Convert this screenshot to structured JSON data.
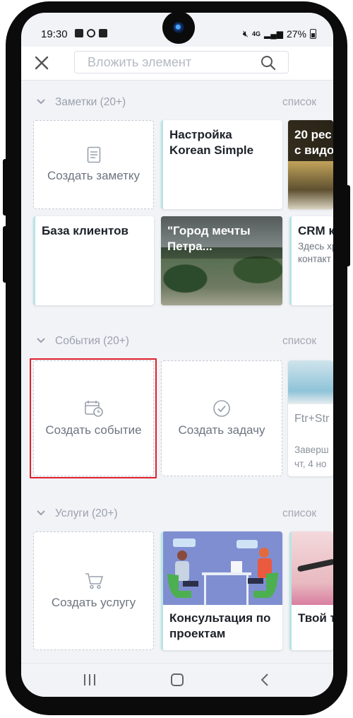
{
  "status_bar": {
    "time": "19:30",
    "network": "4G",
    "battery": "27%"
  },
  "search": {
    "placeholder": "Вложить элемент"
  },
  "sections": [
    {
      "title": "Заметки (20+)",
      "view_label": "список",
      "create_label": "Создать заметку",
      "cards": [
        {
          "title": "Настройка Korean Simple"
        },
        {
          "title": "20 рес\nс видо"
        },
        {
          "title": "База клиентов"
        },
        {
          "title": "\"Город мечты Петра..."
        },
        {
          "title": "CRM к",
          "subtitle": "Здесь хр\nконтакт"
        }
      ]
    },
    {
      "title": "События (20+)",
      "view_label": "список",
      "create_event_label": "Создать событие",
      "create_task_label": "Создать задачу",
      "cards": [
        {
          "title": "Ftr+Str",
          "status": "Заверш",
          "date": "чт, 4 но"
        }
      ]
    },
    {
      "title": "Услуги (20+)",
      "view_label": "список",
      "create_label": "Создать услугу",
      "cards": [
        {
          "title": "Консультация по проектам"
        },
        {
          "title": "Твой т"
        }
      ]
    }
  ],
  "colors": {
    "accent_border": "#b8e5e6",
    "highlight": "#e0212d",
    "muted_text": "#9aa1ad"
  }
}
